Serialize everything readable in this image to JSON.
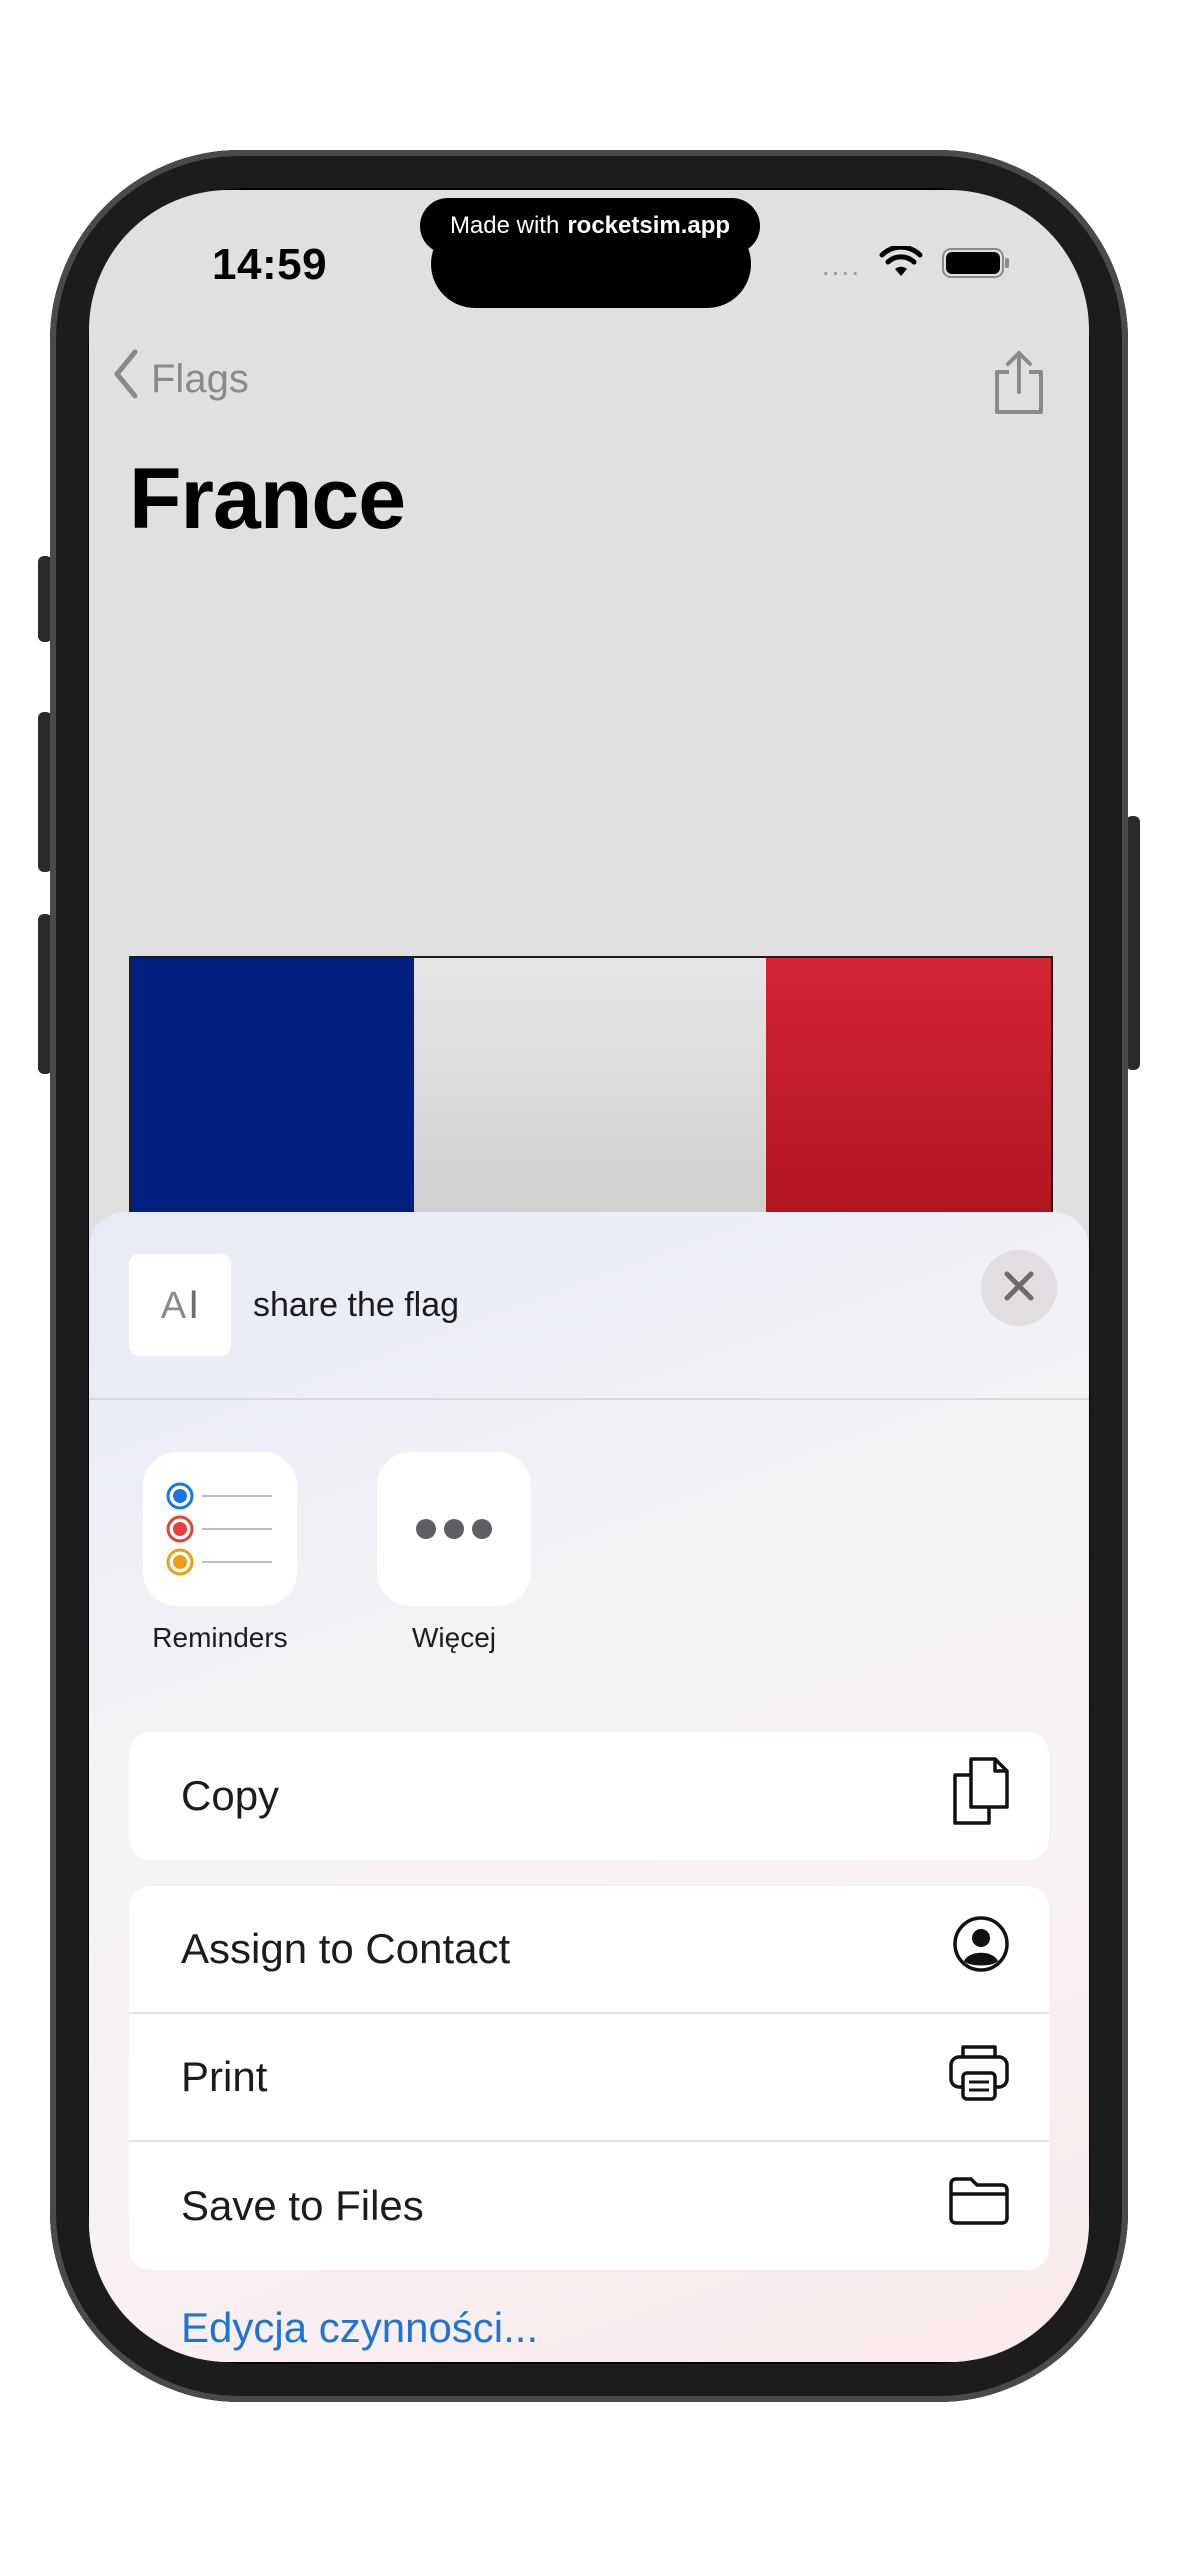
{
  "status_bar": {
    "time": "14:59",
    "made_with_prefix": "Made with",
    "made_with_brand": "rocketsim.app",
    "signal_dots": "....",
    "wifi_icon": "wifi-icon",
    "battery_icon": "battery-icon"
  },
  "nav": {
    "back_label": "Flags",
    "back_icon": "chevron-left-icon",
    "share_icon": "share-icon"
  },
  "page": {
    "title": "France"
  },
  "flag": {
    "colors": [
      "#022080",
      "#d6d6d4",
      "#c51d2a"
    ]
  },
  "share_sheet": {
    "doc_glyph": "A",
    "title": "share the flag",
    "close_icon": "close-icon",
    "apps": [
      {
        "label": "Reminders",
        "icon": "reminders-icon"
      },
      {
        "label": "Więcej",
        "icon": "more-icon"
      }
    ],
    "actions_group1": [
      {
        "label": "Copy",
        "icon": "copy-icon"
      }
    ],
    "actions_group2": [
      {
        "label": "Assign to Contact",
        "icon": "contact-icon"
      },
      {
        "label": "Print",
        "icon": "printer-icon"
      },
      {
        "label": "Save to Files",
        "icon": "folder-icon"
      }
    ],
    "edit_actions_label": "Edycja czynności..."
  },
  "colors": {
    "accent": "#1d74d8"
  }
}
